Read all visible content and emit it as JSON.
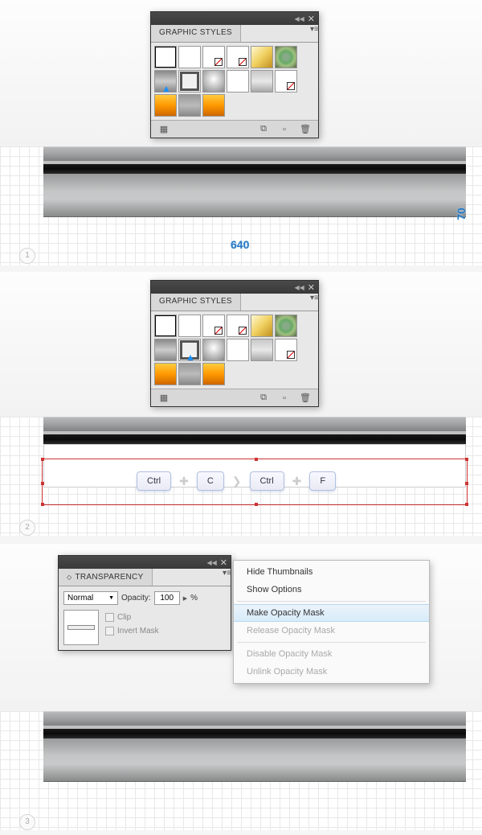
{
  "graphicStylesPanel": {
    "title": "GRAPHIC STYLES"
  },
  "transparencyPanel": {
    "title": "TRANSPARENCY",
    "blendMode": "Normal",
    "opacityLabel": "Opacity:",
    "opacityValue": "100",
    "opacityUnit": "%",
    "clipLabel": "Clip",
    "invertLabel": "Invert Mask"
  },
  "flyoutMenu": {
    "items": [
      {
        "label": "Hide Thumbnails",
        "state": "normal"
      },
      {
        "label": "Show Options",
        "state": "normal"
      },
      {
        "label": "Make Opacity Mask",
        "state": "hover"
      },
      {
        "label": "Release Opacity Mask",
        "state": "disabled"
      },
      {
        "label": "Disable Opacity Mask",
        "state": "disabled"
      },
      {
        "label": "Unlink Opacity Mask",
        "state": "disabled"
      }
    ]
  },
  "dimensions": {
    "width": "640",
    "height": "70"
  },
  "shortcut": {
    "k1": "Ctrl",
    "k2": "C",
    "k3": "Ctrl",
    "k4": "F"
  },
  "steps": {
    "s1": "1",
    "s2": "2",
    "s3": "3"
  }
}
